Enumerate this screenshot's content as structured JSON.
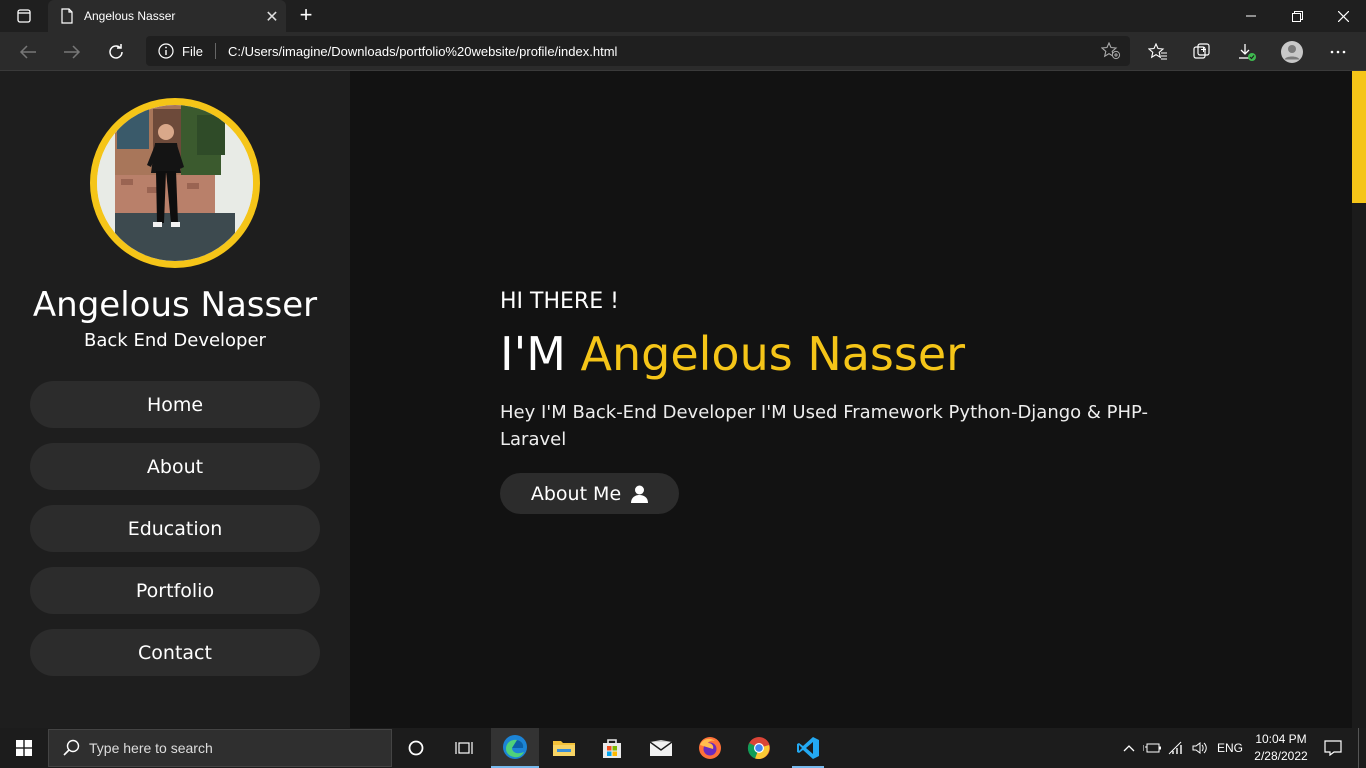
{
  "browser": {
    "tab_title": "Angelous Nasser",
    "address_scheme": "File",
    "url": "C:/Users/imagine/Downloads/portfolio%20website/profile/index.html"
  },
  "sidebar": {
    "name": "Angelous Nasser",
    "role": "Back End Developer",
    "nav": [
      {
        "label": "Home"
      },
      {
        "label": "About"
      },
      {
        "label": "Education"
      },
      {
        "label": "Portfolio"
      },
      {
        "label": "Contact"
      }
    ]
  },
  "hero": {
    "greeting": "HI THERE !",
    "intro_prefix": "I'M",
    "name": "Angelous Nasser",
    "description": "Hey I'M Back-End Developer I'M Used Framework Python-Django & PHP-Laravel",
    "button_label": "About Me"
  },
  "taskbar": {
    "search_placeholder": "Type here to search",
    "language": "ENG",
    "time": "10:04 PM",
    "date": "2/28/2022"
  },
  "colors": {
    "accent": "#f5c518",
    "sidebar_bg": "#1e1e1e",
    "page_bg": "#121212"
  }
}
